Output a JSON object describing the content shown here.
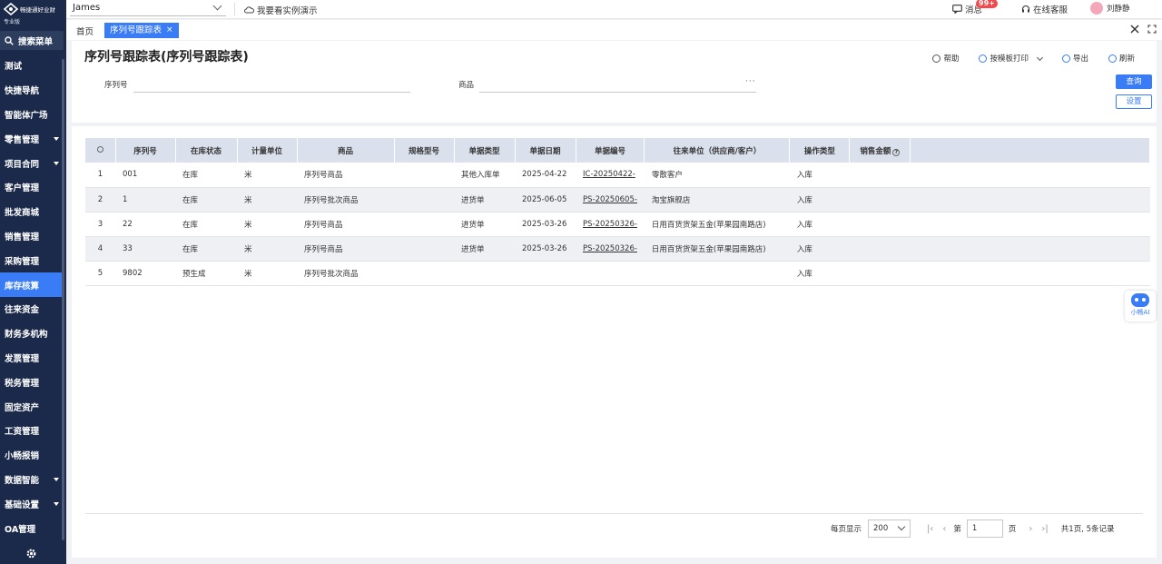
{
  "sidebar": {
    "logo_text": "畅捷通好业财",
    "edition": "专业版",
    "search_label": "搜索菜单",
    "items": [
      {
        "label": "测试",
        "has_caret": false
      },
      {
        "label": "快捷导航",
        "has_caret": false
      },
      {
        "label": "智能体广场",
        "has_caret": false
      },
      {
        "label": "零售管理",
        "has_caret": true
      },
      {
        "label": "项目合同",
        "has_caret": true
      },
      {
        "label": "客户管理",
        "has_caret": false
      },
      {
        "label": "批发商城",
        "has_caret": false
      },
      {
        "label": "销售管理",
        "has_caret": false
      },
      {
        "label": "采购管理",
        "has_caret": false
      },
      {
        "label": "库存核算",
        "has_caret": false,
        "active": true
      },
      {
        "label": "往来资金",
        "has_caret": false
      },
      {
        "label": "财务多机构",
        "has_caret": false
      },
      {
        "label": "发票管理",
        "has_caret": false
      },
      {
        "label": "税务管理",
        "has_caret": false
      },
      {
        "label": "固定资产",
        "has_caret": false
      },
      {
        "label": "工资管理",
        "has_caret": false
      },
      {
        "label": "小畅报销",
        "has_caret": false
      },
      {
        "label": "数据智能",
        "has_caret": true
      },
      {
        "label": "基础设置",
        "has_caret": true
      },
      {
        "label": "OA管理",
        "has_caret": false
      }
    ]
  },
  "topbar": {
    "company": "James",
    "demo_link": "我要看实例演示",
    "messages_label": "消息",
    "messages_badge": "99+",
    "service_label": "在线客服",
    "user_name": "刘静静"
  },
  "tabs": {
    "home": "首页",
    "active": "序列号跟踪表"
  },
  "page": {
    "title": "序列号跟踪表(序列号跟踪表)",
    "actions": {
      "help": "帮助",
      "print": "按模板打印",
      "export": "导出",
      "refresh": "刷新"
    },
    "filters": {
      "serial_label": "序列号",
      "product_label": "商品",
      "product_more": "···"
    },
    "query_button": "查询",
    "settings_button": "设置"
  },
  "table": {
    "columns": [
      "",
      "序列号",
      "在库状态",
      "计量单位",
      "商品",
      "规格型号",
      "单据类型",
      "单据日期",
      "单据编号",
      "往来单位（供应商/客户）",
      "操作类型",
      "销售金额"
    ],
    "rows": [
      {
        "idx": "1",
        "serial": "001",
        "status": "在库",
        "unit": "米",
        "product": "序列号商品",
        "spec": "",
        "doc_type": "其他入库单",
        "doc_date": "2025-04-22",
        "doc_no": "IC-20250422-",
        "partner": "零散客户",
        "op": "入库",
        "amount": ""
      },
      {
        "idx": "2",
        "serial": "1",
        "status": "在库",
        "unit": "米",
        "product": "序列号批次商品",
        "spec": "",
        "doc_type": "进货单",
        "doc_date": "2025-06-05",
        "doc_no": "PS-20250605-",
        "partner": "淘宝旗舰店",
        "op": "入库",
        "amount": ""
      },
      {
        "idx": "3",
        "serial": "22",
        "status": "在库",
        "unit": "米",
        "product": "序列号商品",
        "spec": "",
        "doc_type": "进货单",
        "doc_date": "2025-03-26",
        "doc_no": "PS-20250326-",
        "partner": "日用百货货架五金(苹果园南路店)",
        "op": "入库",
        "amount": ""
      },
      {
        "idx": "4",
        "serial": "33",
        "status": "在库",
        "unit": "米",
        "product": "序列号商品",
        "spec": "",
        "doc_type": "进货单",
        "doc_date": "2025-03-26",
        "doc_no": "PS-20250326-",
        "partner": "日用百货货架五金(苹果园南路店)",
        "op": "入库",
        "amount": ""
      },
      {
        "idx": "5",
        "serial": "9802",
        "status": "预生成",
        "unit": "米",
        "product": "序列号批次商品",
        "spec": "",
        "doc_type": "",
        "doc_date": "",
        "doc_no": "",
        "partner": "",
        "op": "入库",
        "amount": ""
      }
    ]
  },
  "pager": {
    "per_page_label": "每页显示",
    "page_size": "200",
    "page_prefix": "第",
    "page_value": "1",
    "page_suffix": "页",
    "summary": "共1页, 5条记录"
  },
  "ai_widget": {
    "label": "小畅AI"
  },
  "colors": {
    "sidebar": "#1b2a4a",
    "accent": "#3a7cf6",
    "header_row": "#dbe1ec"
  }
}
